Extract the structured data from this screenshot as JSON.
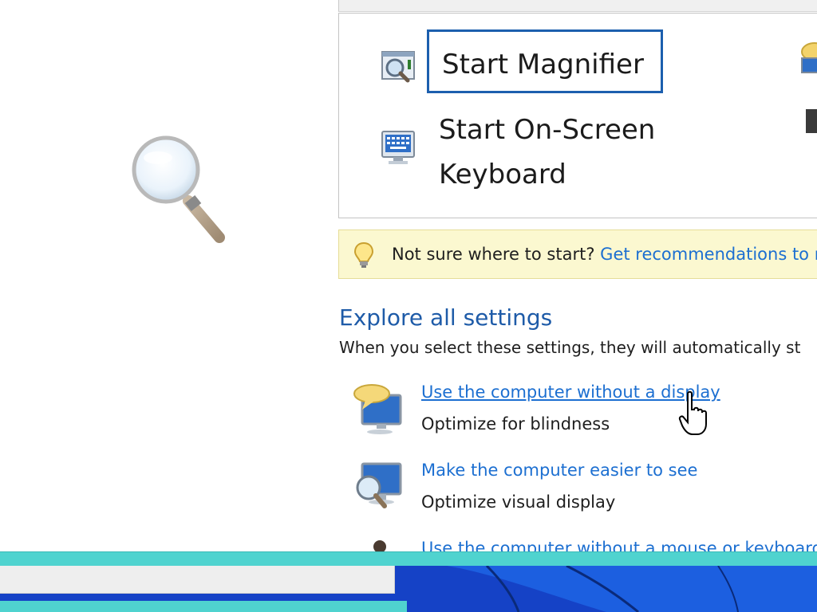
{
  "quick_access": {
    "items": [
      {
        "label": "Start Magnifier",
        "icon": "magnifier-app-icon"
      },
      {
        "label": "Start On-Screen Keyboard",
        "icon": "on-screen-keyboard-icon"
      }
    ]
  },
  "tip": {
    "text": "Not sure where to start?",
    "link": "Get recommendations to m"
  },
  "explore": {
    "title": "Explore all settings",
    "description": "When you select these settings, they will automatically st",
    "items": [
      {
        "link": "Use the computer without a display",
        "sub": "Optimize for blindness",
        "icon": "speech-bubble-monitor-icon"
      },
      {
        "link": "Make the computer easier to see",
        "sub": "Optimize visual display",
        "icon": "magnifier-monitor-icon"
      },
      {
        "link": "Use the computer without a mouse or keyboard",
        "sub": "",
        "icon": "person-icon"
      }
    ]
  },
  "colors": {
    "link": "#1c6fd1",
    "heading": "#1e5ba8",
    "focus": "#1c5fae",
    "tip_bg": "#fbf8d0",
    "teal": "#4fd3cf",
    "taskbar": "#1147c9"
  }
}
